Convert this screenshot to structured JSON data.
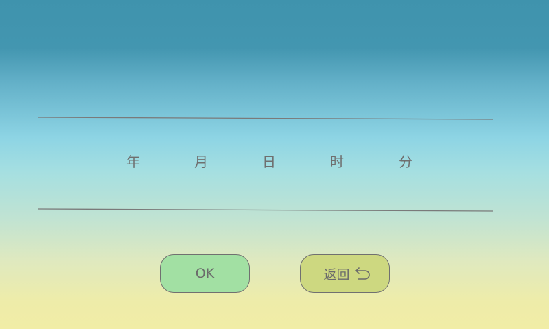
{
  "picker": {
    "units": {
      "year": "年",
      "month": "月",
      "day": "日",
      "hour": "时",
      "minute": "分"
    }
  },
  "buttons": {
    "ok_label": "OK",
    "back_label": "返回",
    "back_icon": "return-arrow-icon"
  },
  "colors": {
    "ok_button": "#a2e0a3",
    "back_button": "#cdd880",
    "text": "#6f6f6f",
    "divider": "#7a7a7a"
  }
}
